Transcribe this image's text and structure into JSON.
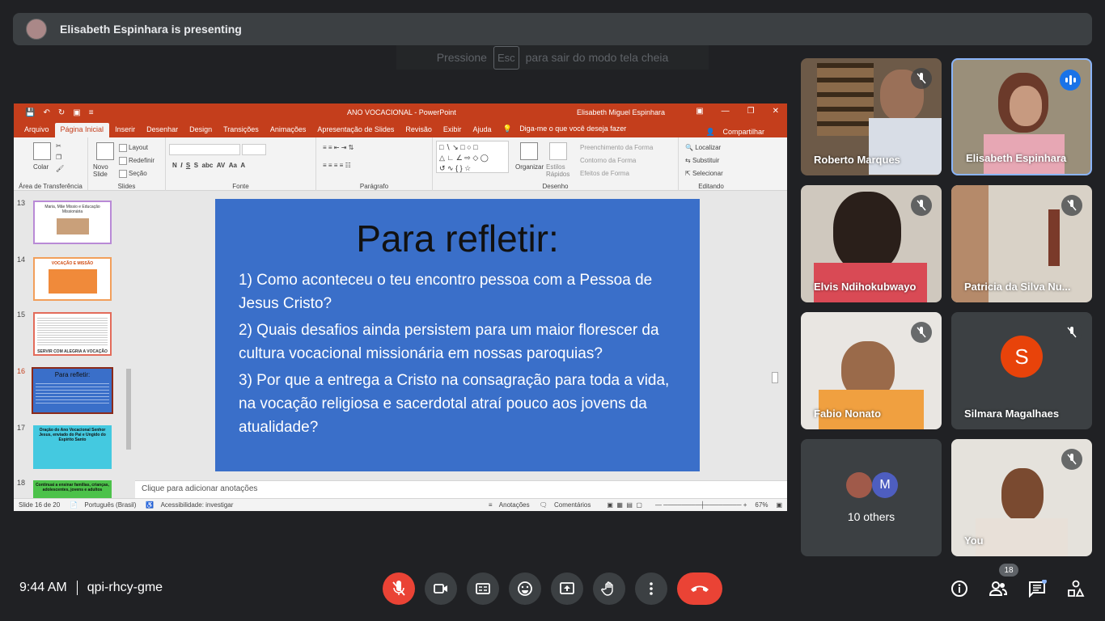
{
  "banner": {
    "text": "Elisabeth Espinhara is presenting"
  },
  "esc_hint": {
    "before": "Pressione",
    "key": "Esc",
    "after": "para sair do modo tela cheia"
  },
  "ppt": {
    "doc_title": "ANO VOCACIONAL",
    "app": "PowerPoint",
    "user": "Elisabeth Miguel Espinhara",
    "tabs": [
      "Arquivo",
      "Página Inicial",
      "Inserir",
      "Desenhar",
      "Design",
      "Transições",
      "Animações",
      "Apresentação de Slides",
      "Revisão",
      "Exibir",
      "Ajuda"
    ],
    "tell_me": "Diga-me o que você deseja fazer",
    "share": "Compartilhar",
    "groups": {
      "clipboard": "Área de Transferência",
      "slides": "Slides",
      "font": "Fonte",
      "paragraph": "Parágrafo",
      "drawing": "Desenho",
      "editing": "Editando"
    },
    "buttons": {
      "paste": "Colar",
      "new_slide": "Novo Slide",
      "layout": "Layout",
      "reset": "Redefinir",
      "section": "Seção",
      "organize": "Organizar",
      "quick_styles": "Estilos Rápidos",
      "shape_fill": "Preenchimento da Forma",
      "shape_outline": "Contorno da Forma",
      "shape_effects": "Efeitos de Forma",
      "find": "Localizar",
      "replace": "Substituir",
      "select": "Selecionar"
    },
    "thumbnails": [
      {
        "num": "13",
        "text": "Maria, Mãe Missio e Educação Missionária"
      },
      {
        "num": "14",
        "text": "VOCAÇÃO E MISSÃO"
      },
      {
        "num": "15",
        "text": "SERVIR COM ALEGRIA A VOCAÇÃO"
      },
      {
        "num": "16",
        "text": "Para refletir:"
      },
      {
        "num": "17",
        "text": "Oração do Ano Vocacional Senhor Jesus, enviado do Pai e Ungido do Espírito Santo"
      },
      {
        "num": "18",
        "text": "Continuai a ensinar famílias, crianças, adolescentes, jovens e adultos"
      }
    ],
    "slide": {
      "title": "Para refletir:",
      "items": [
        "1) Como aconteceu o teu encontro pessoa com a Pessoa de Jesus Cristo?",
        "2) Quais desafios ainda persistem para um maior florescer da cultura vocacional missionária em nossas paroquias?",
        "3) Por que a entrega a Cristo na consagração para toda a vida, na vocação religiosa e sacerdotal atraí pouco aos jovens da atualidade?"
      ]
    },
    "notes_placeholder": "Clique para adicionar anotações",
    "status": {
      "slide_count": "Slide 16 de 20",
      "language": "Português (Brasil)",
      "accessibility": "Acessibilidade: investigar",
      "notes": "Anotações",
      "comments": "Comentários",
      "zoom": "67%"
    }
  },
  "participants": [
    {
      "name": "Roberto Marques",
      "muted": true
    },
    {
      "name": "Elisabeth Espinhara",
      "muted": false,
      "speaking": true
    },
    {
      "name": "Elvis Ndihokubwayo",
      "muted": true
    },
    {
      "name": "Patricia da Silva Nu...",
      "muted": true
    },
    {
      "name": "Fabio Nonato",
      "muted": true
    },
    {
      "name": "Silmara Magalhaes",
      "muted": true,
      "initial": "S"
    },
    {
      "name": "10 others",
      "initial": "M"
    },
    {
      "name": "You",
      "muted": true
    }
  ],
  "bottom": {
    "time": "9:44 AM",
    "meeting_code": "qpi-rhcy-gme",
    "people_count": "18"
  },
  "colors": {
    "bg": "#202124",
    "tile": "#3c4043",
    "ppt_accent": "#c43e1c",
    "slide_bg": "#3a6fc9",
    "end_call": "#ea4335",
    "avatar_s": "#e8430a"
  }
}
